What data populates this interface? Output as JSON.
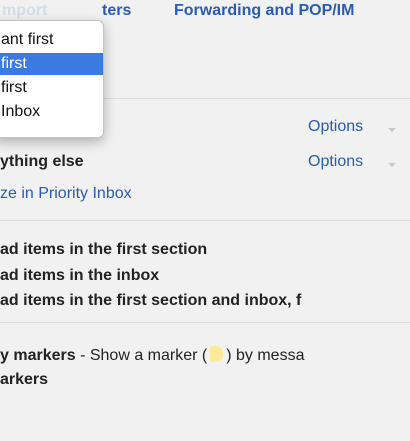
{
  "tabs": {
    "faded": "mport",
    "filters": "ters",
    "forwarding": "Forwarding and POP/IM"
  },
  "dropdown": {
    "items": [
      {
        "label": "ant first",
        "selected": false
      },
      {
        "label": "first",
        "selected": true
      },
      {
        "label": "first",
        "selected": false
      },
      {
        "label": "Inbox",
        "selected": false
      }
    ]
  },
  "sections": {
    "options_1": "Options",
    "options_2": "Options",
    "everything_else": "ything else",
    "add_section_link": "ze in Priority Inbox"
  },
  "unread_count": {
    "option_1": "ad items in the first section",
    "option_2": "ad items in the inbox",
    "option_3": "ad items in the first section and inbox, f"
  },
  "importance_markers": {
    "show_label": "y markers",
    "show_desc_prefix": " - Show a marker (",
    "show_desc_suffix": ") by messa",
    "no_label": "arkers"
  },
  "colors": {
    "link": "#2a5db0",
    "background": "#f1f1f1",
    "selected": "#3b7ae0",
    "marker": "#fce99a"
  }
}
